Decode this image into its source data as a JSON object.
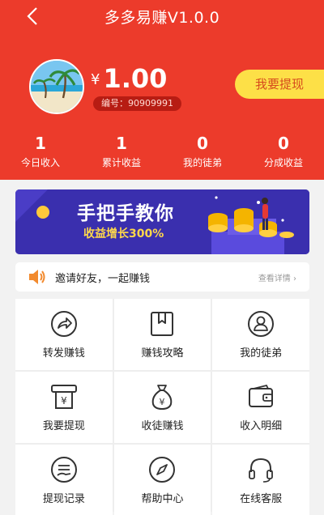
{
  "header": {
    "title": "多多易赚V1.0.0",
    "currency": "¥",
    "balance": "1.00",
    "user_id": "编号：90909991",
    "withdraw_label": "我要提现",
    "stats": [
      {
        "value": "1",
        "label": "今日收入"
      },
      {
        "value": "1",
        "label": "累计收益"
      },
      {
        "value": "0",
        "label": "我的徒弟"
      },
      {
        "value": "0",
        "label": "分成收益"
      }
    ]
  },
  "banner": {
    "title": "手把手教你",
    "subtitle": "收益增长300%"
  },
  "notice": {
    "text": "邀请好友，一起赚钱",
    "more": "查看详情"
  },
  "menu": [
    {
      "label": "转发赚钱",
      "icon": "share-icon"
    },
    {
      "label": "赚钱攻略",
      "icon": "bookmark-icon"
    },
    {
      "label": "我的徒弟",
      "icon": "user-icon"
    },
    {
      "label": "我要提现",
      "icon": "atm-icon"
    },
    {
      "label": "收徒赚钱",
      "icon": "money-bag-icon"
    },
    {
      "label": "收入明细",
      "icon": "wallet-icon"
    },
    {
      "label": "提现记录",
      "icon": "record-icon"
    },
    {
      "label": "帮助中心",
      "icon": "compass-icon"
    },
    {
      "label": "在线客服",
      "icon": "headset-icon"
    }
  ],
  "colors": {
    "brand": "#ec3b2b",
    "accent": "#fde047",
    "banner": "#3a2fae"
  }
}
